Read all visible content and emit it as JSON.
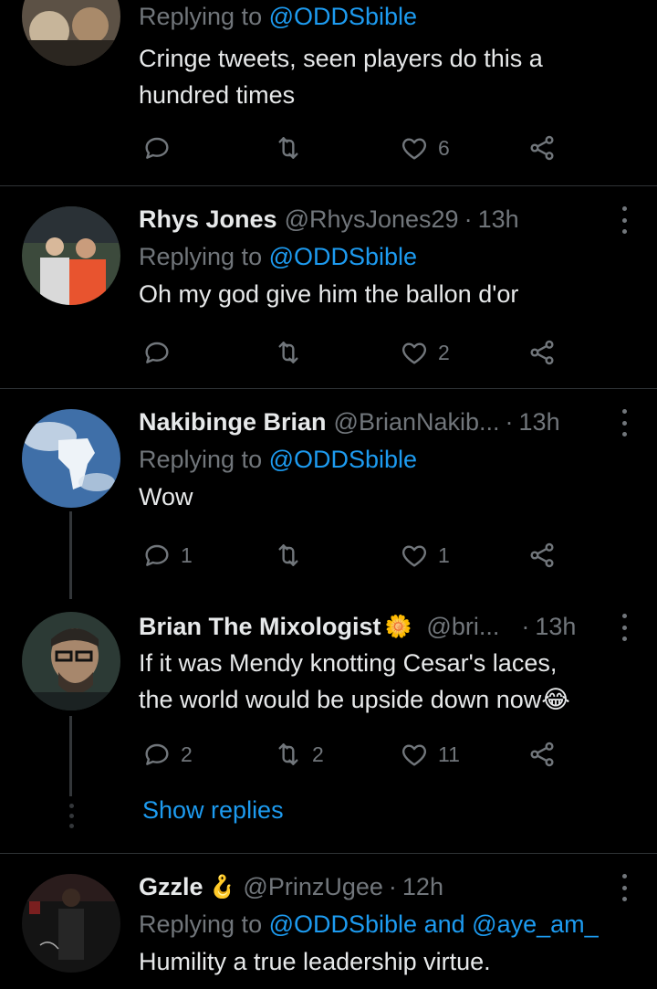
{
  "tweets": [
    {
      "replying_label": "Replying to",
      "replying_to": "@ODDSbible",
      "text_lines": [
        "Cringe tweets, seen players do this a",
        "hundred times"
      ],
      "likes": "6"
    },
    {
      "name": "Rhys Jones",
      "handle": "@RhysJones29",
      "time": "13h",
      "replying_label": "Replying to",
      "replying_to": "@ODDSbible",
      "text": "Oh my god give him the ballon d'or",
      "likes": "2"
    },
    {
      "name": "Nakibinge Brian",
      "handle": "@BrianNakib...",
      "time": "13h",
      "replying_label": "Replying to",
      "replying_to": "@ODDSbible",
      "text": "Wow",
      "replies": "1",
      "likes": "1"
    },
    {
      "name": "Brian The Mixologist",
      "name_emoji": "🌼",
      "handle": "@bri...",
      "time": "13h",
      "text_lines": [
        "If it was Mendy knotting Cesar's laces,",
        "the world would be upside down now"
      ],
      "text_emoji": "😂",
      "replies": "2",
      "retweets": "2",
      "likes": "11"
    },
    {
      "name": "Gzzle",
      "name_emoji": "🪝",
      "handle": "@PrinzUgee",
      "time": "12h",
      "replying_label": "Replying to",
      "replying_to": "@ODDSbible",
      "replying_and": "and",
      "replying_to_2": "@aye_am_",
      "text": "Humility a true leadership virtue."
    }
  ],
  "show_replies": "Show replies",
  "separator": "·",
  "icons": [
    "reply-icon",
    "retweet-icon",
    "like-icon",
    "share-icon",
    "more-icon"
  ],
  "colors": {
    "background": "#000000",
    "text": "#e7e9ea",
    "secondary": "#71767b",
    "link": "#1d9bf0",
    "divider": "#2f3336"
  }
}
